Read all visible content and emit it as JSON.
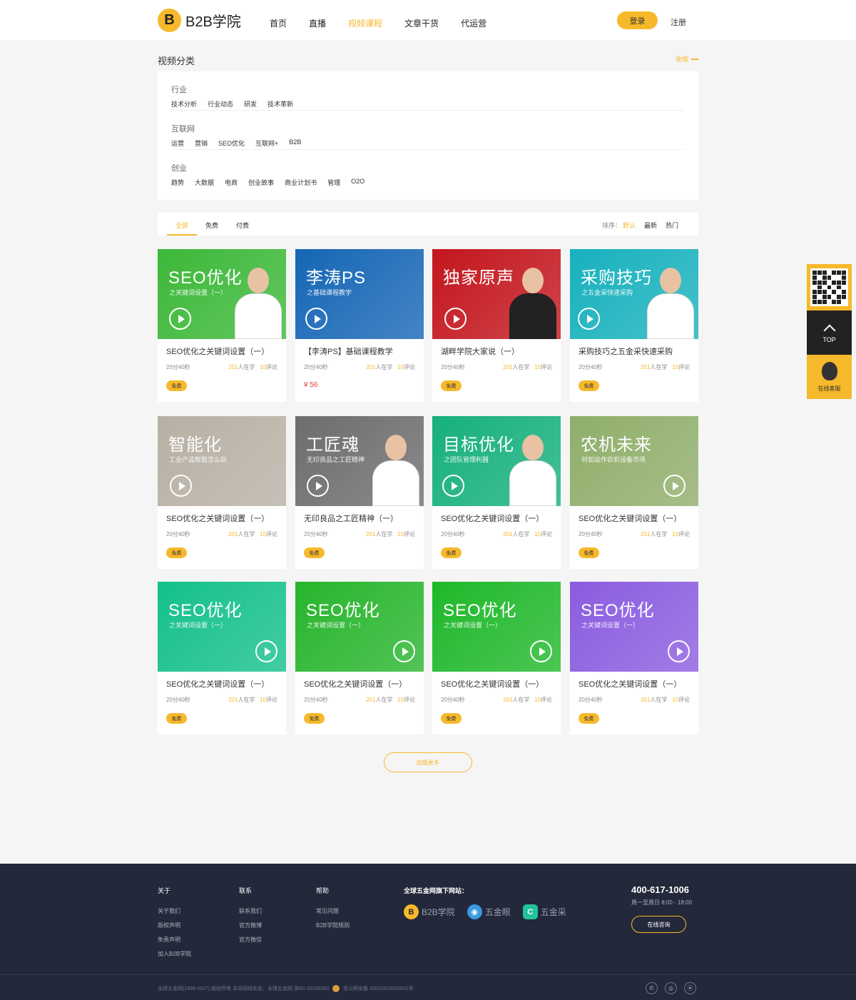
{
  "header": {
    "logo_letter": "B",
    "logo_text": "B2B学院",
    "nav": [
      "首页",
      "直播",
      "视频课程",
      "文章干货",
      "代运营"
    ],
    "active_nav": "视频课程",
    "login": "登录",
    "register": "注册"
  },
  "category": {
    "title": "视频分类",
    "collapse": "收缩",
    "groups": [
      {
        "name": "行业",
        "items": [
          "技术分析",
          "行业动态",
          "研发",
          "技术革新"
        ]
      },
      {
        "name": "互联网",
        "items": [
          "运营",
          "营销",
          "SEO优化",
          "互联网+",
          "B2B"
        ]
      },
      {
        "name": "创业",
        "items": [
          "趋势",
          "大数据",
          "电商",
          "创业故事",
          "商业计划书",
          "管理",
          "O2O"
        ]
      }
    ]
  },
  "filter": {
    "tabs": [
      "全部",
      "免费",
      "付费"
    ],
    "sort_label": "排序：",
    "sort": [
      "默认",
      "最新",
      "热门"
    ]
  },
  "cards": [
    {
      "thumb_title": "SEO优化",
      "thumb_sub": "之关键词设置（一）",
      "title": "SEO优化之关键词设置（一）",
      "duration": "20分40秒",
      "learners": "201",
      "learners_label": "人在学",
      "comments": "10",
      "comments_label": "评论",
      "tag": "免费",
      "bg": "#3cb838"
    },
    {
      "thumb_title": "李涛PS",
      "thumb_sub": "之基础课程教学",
      "title": "【李涛PS】基础课程教学",
      "duration": "20分40秒",
      "learners": "201",
      "learners_label": "人在学",
      "comments": "10",
      "comments_label": "评论",
      "price": "¥ 56",
      "bg": "#1566b5"
    },
    {
      "thumb_title": "独家原声",
      "thumb_sub": "",
      "title": "湖畔学院大家说（一）",
      "duration": "20分40秒",
      "learners": "201",
      "learners_label": "人在学",
      "comments": "10",
      "comments_label": "评论",
      "tag": "免费",
      "bg": "#c3161d"
    },
    {
      "thumb_title": "采购技巧",
      "thumb_sub": "之五金采快速采购",
      "title": "采购技巧之五金采快速采购",
      "duration": "20分40秒",
      "learners": "201",
      "learners_label": "人在学",
      "comments": "10",
      "comments_label": "评论",
      "tag": "免费",
      "bg": "#17b1bd"
    },
    {
      "thumb_title": "智能化",
      "thumb_sub": "工业产品智能怎么玩",
      "title": "SEO优化之关键词设置（一）",
      "duration": "20分40秒",
      "learners": "201",
      "learners_label": "人在学",
      "comments": "10",
      "comments_label": "评论",
      "tag": "免费",
      "bg": "#b7b0a4"
    },
    {
      "thumb_title": "工匠魂",
      "thumb_sub": "无印良品之工匠精神",
      "title": "无印良品之工匠精神（一）",
      "duration": "20分40秒",
      "learners": "201",
      "learners_label": "人在学",
      "comments": "10",
      "comments_label": "评论",
      "tag": "免费",
      "bg": "#6d6d6f"
    },
    {
      "thumb_title": "目标优化",
      "thumb_sub": "之团队管理利器",
      "title": "SEO优化之关键词设置（一）",
      "duration": "20分40秒",
      "learners": "201",
      "learners_label": "人在学",
      "comments": "10",
      "comments_label": "评论",
      "tag": "免费",
      "bg": "#16b07c"
    },
    {
      "thumb_title": "农机未来",
      "thumb_sub": "何如运作农机设备市场",
      "title": "SEO优化之关键词设置（一）",
      "duration": "20分40秒",
      "learners": "201",
      "learners_label": "人在学",
      "comments": "10",
      "comments_label": "评论",
      "tag": "免费",
      "bg": "#8fae6a"
    },
    {
      "thumb_title": "SEO优化",
      "thumb_sub": "之关键词设置（一）",
      "title": "SEO优化之关键词设置（一）",
      "duration": "20分40秒",
      "learners": "201",
      "learners_label": "人在学",
      "comments": "10",
      "comments_label": "评论",
      "tag": "免费",
      "bg": "#14c08a"
    },
    {
      "thumb_title": "SEO优化",
      "thumb_sub": "之关键词设置（一）",
      "title": "SEO优化之关键词设置（一）",
      "duration": "20分40秒",
      "learners": "201",
      "learners_label": "人在学",
      "comments": "10",
      "comments_label": "评论",
      "tag": "免费",
      "bg": "#27b52c"
    },
    {
      "thumb_title": "SEO优化",
      "thumb_sub": "之关键词设置（一）",
      "title": "SEO优化之关键词设置（一）",
      "duration": "20分40秒",
      "learners": "201",
      "learners_label": "人在学",
      "comments": "10",
      "comments_label": "评论",
      "tag": "免费",
      "bg": "#1fb82a"
    },
    {
      "thumb_title": "SEO优化",
      "thumb_sub": "之关键词设置（一）",
      "title": "SEO优化之关键词设置（一）",
      "duration": "20分40秒",
      "learners": "201",
      "learners_label": "人在学",
      "comments": "10",
      "comments_label": "评论",
      "tag": "免费",
      "bg": "#8a5ce0"
    }
  ],
  "load_more": "加载更多",
  "sidebar": {
    "top": "TOP",
    "service": "在线客服"
  },
  "footer": {
    "cols": [
      {
        "h": "关于",
        "links": [
          "关于我们",
          "版权声明",
          "免责声明",
          "加入B2B学院"
        ]
      },
      {
        "h": "联系",
        "links": [
          "联系我们",
          "官方微博",
          "官方微信"
        ]
      },
      {
        "h": "帮助",
        "links": [
          "常见问题",
          "B2B学院规则"
        ]
      }
    ],
    "sites_title": "全球五金网旗下网站：",
    "sites": [
      {
        "name": "B2B学院",
        "icon": "B",
        "color": "#f6b92b"
      },
      {
        "name": "五金眼",
        "icon": "◉",
        "color": "#3a9be0"
      },
      {
        "name": "五金采",
        "icon": "C",
        "color": "#22c39a"
      }
    ],
    "phone": "400-617-1006",
    "hours": "周一至周日 8:00 - 18:00",
    "consult": "在线咨询",
    "copyright": "全球五金网(1999-2017) 版权所有 本站网络实名：全球五金网 浙B2-20100360",
    "police": "浙公网安备 33010502000502号"
  }
}
